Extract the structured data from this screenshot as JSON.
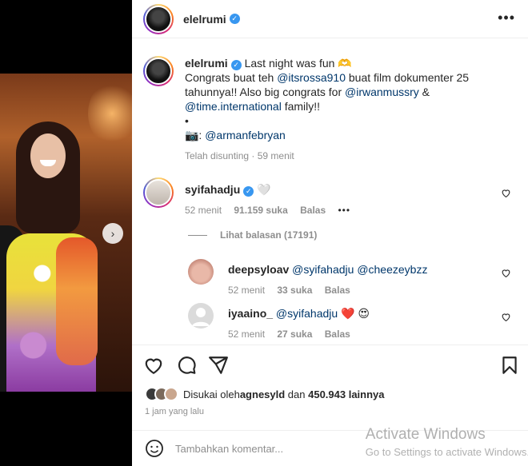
{
  "post": {
    "username": "elelrumi"
  },
  "caption": {
    "username": "elelrumi",
    "line1": "Last night was fun 🫶",
    "congrats_prefix": "Congrats buat teh ",
    "mention1": "@itsrossa910",
    "congrats_suffix": " buat film dokumenter 25 tahunnya!! Also big congrats for ",
    "mention2": "@irwanmussry",
    "amp": " & ",
    "mention3": "@time.international",
    "family": " family!!",
    "bullet": "•",
    "camera": "📷: ",
    "mention4": "@armanfebryan",
    "edited": "Telah disunting",
    "dot": " · ",
    "time": "59 menit"
  },
  "comments": [
    {
      "username": "syifahadju",
      "text": "🤍",
      "time": "52 menit",
      "likes": "91.159 suka",
      "reply": "Balas",
      "more": "•••"
    }
  ],
  "view_replies": "Lihat balasan (17191)",
  "replies": [
    {
      "username": "deepsyloav",
      "mention_a": "@syifahadju",
      "mention_b": "@cheezeybzz",
      "time": "52 menit",
      "likes": "33 suka",
      "reply": "Balas"
    },
    {
      "username": "iyaaino_",
      "mention_a": "@syifahadju",
      "emoji": " ❤️ 😍",
      "time": "52 menit",
      "likes": "27 suka",
      "reply": "Balas"
    }
  ],
  "likes": {
    "prefix": "Disukai oleh ",
    "user": "agnesyld",
    "mid": " dan ",
    "count": "450.943 lainnya"
  },
  "timestamp": "1 jam yang lalu",
  "add_comment": {
    "placeholder": "Tambahkan komentar..."
  },
  "watermark": {
    "line1": "Activate Windows",
    "line2": "Go to Settings to activate Windows."
  },
  "colors": {
    "link": "#00376b",
    "verified": "#3897f0",
    "muted": "#8e8e8e",
    "heart": "#ed4956"
  }
}
